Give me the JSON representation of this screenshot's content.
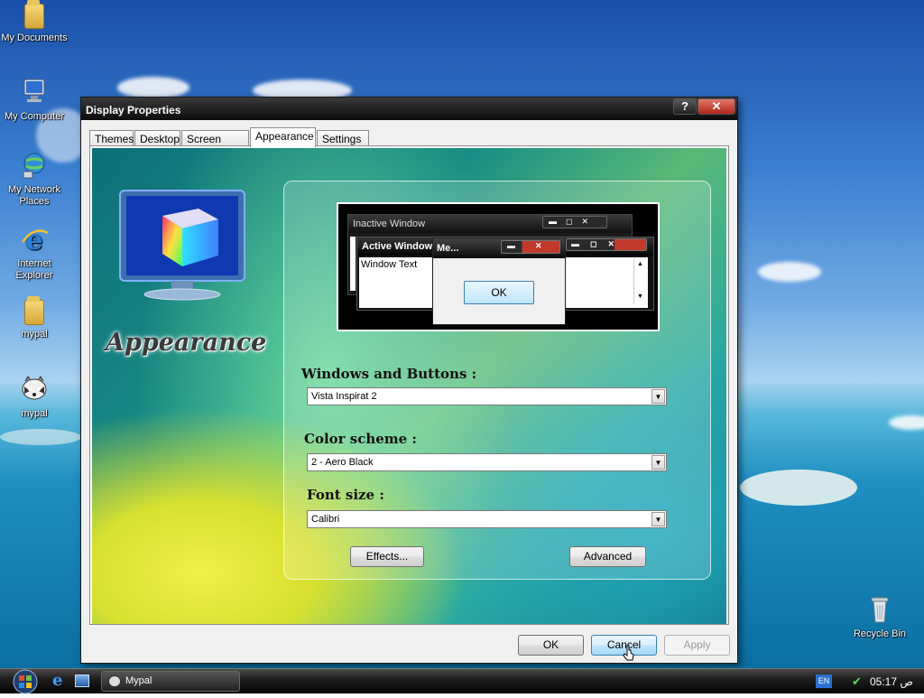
{
  "desktop": {
    "icons": [
      {
        "label": "My Documents"
      },
      {
        "label": "My Computer"
      },
      {
        "label": "My Network Places"
      },
      {
        "label": "Internet Explorer"
      },
      {
        "label": "mypal"
      },
      {
        "label": "mypal"
      }
    ],
    "recycle_bin": "Recycle Bin"
  },
  "dialog": {
    "title": "Display Properties",
    "help": "?",
    "close": "✕",
    "tabs": [
      "Themes",
      "Desktop",
      "Screen Saver",
      "Appearance",
      "Settings"
    ],
    "active_tab": "Appearance",
    "heading": "Appearance",
    "preview": {
      "inactive": "Inactive Window",
      "active": "Active Window",
      "text": "Window Text",
      "message": "Me...",
      "ok": "OK"
    },
    "windows_buttons_label": "Windows and Buttons :",
    "windows_buttons_value": "Vista Inspirat 2",
    "color_scheme_label": "Color scheme :",
    "color_scheme_value": "2 - Aero Black",
    "font_size_label": "Font size :",
    "font_size_value": "Calibri",
    "effects": "Effects...",
    "advanced": "Advanced",
    "ok": "OK",
    "cancel": "Cancel",
    "apply": "Apply"
  },
  "taskbar": {
    "task": "Mypal",
    "lang": "EN",
    "clock": "ص 05:17"
  }
}
